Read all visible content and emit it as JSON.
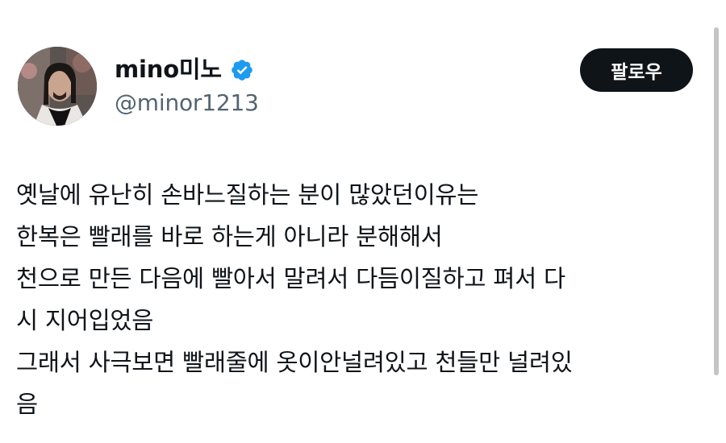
{
  "profile": {
    "display_name": "mino미노",
    "handle": "@minor1213",
    "verified": true
  },
  "follow_button": {
    "label": "팔로우"
  },
  "tweet": {
    "lines": [
      "옛날에 유난히 손바느질하는 분이 많았던이유는",
      "한복은 빨래를 바로 하는게 아니라 분해해서",
      "천으로 만든 다음에 빨아서 말려서 다듬이질하고 펴서 다",
      "시 지어입었음",
      "그래서 사극보면 빨래줄에 옷이안널려있고 천들만 널려있",
      "음"
    ]
  },
  "colors": {
    "text": "#0f1419",
    "secondary_text": "#536471",
    "button_bg": "#0f1419",
    "button_text": "#ffffff",
    "verified_badge": "#1d9bf0",
    "scrollbar": "#c4c4c4"
  }
}
